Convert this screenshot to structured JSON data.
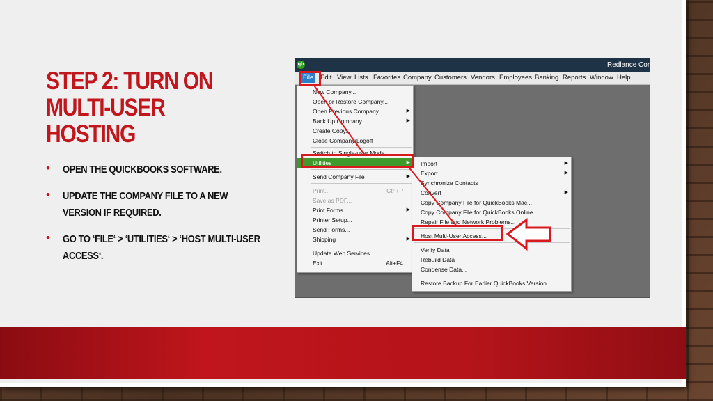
{
  "slide": {
    "title": "Step 2: Turn on Multi-User Hosting",
    "bullets": [
      "Open the QuickBooks software.",
      "Update the company file to a new version if required.",
      "Go to ‘File‘ > ‘Utilities‘ > ‘Host Multi-User Access‘."
    ],
    "bullet_symbol": "•"
  },
  "colors": {
    "accent_red": "#c0161c",
    "qb_green": "#2ca01c",
    "highlight_green": "#3d9a2b"
  },
  "screenshot": {
    "logo_text": "qb",
    "window_title": "Redlance Com",
    "menu": [
      "File",
      "Edit",
      "View",
      "Lists",
      "Favorites",
      "Company",
      "Customers",
      "Vendors",
      "Employees",
      "Banking",
      "Reports",
      "Window",
      "Help"
    ],
    "file_menu": [
      {
        "label": "New Company...",
        "disabled": false
      },
      {
        "label": "Open or Restore Company...",
        "disabled": false
      },
      {
        "label": "Open Previous Company",
        "submenu": true
      },
      {
        "label": "Back Up Company",
        "submenu": true
      },
      {
        "label": "Create Copy...",
        "disabled": false
      },
      {
        "label": "Close Company/Logoff",
        "disabled": false
      },
      {
        "label": "Switch to Single-user Mode",
        "disabled": false
      },
      {
        "label": "Utilities",
        "submenu": true,
        "highlight": true
      },
      {
        "label": "Send Company File",
        "submenu": true
      },
      {
        "label": "Print...",
        "shortcut": "Ctrl+P",
        "disabled": true
      },
      {
        "label": "Save as PDF...",
        "disabled": true
      },
      {
        "label": "Print Forms",
        "submenu": true
      },
      {
        "label": "Printer Setup...",
        "disabled": false
      },
      {
        "label": "Send Forms...",
        "disabled": false
      },
      {
        "label": "Shipping",
        "submenu": true
      },
      {
        "label": "Update Web Services",
        "disabled": false
      },
      {
        "label": "Exit",
        "shortcut": "Alt+F4"
      }
    ],
    "utilities_menu": [
      {
        "label": "Import",
        "submenu": true
      },
      {
        "label": "Export",
        "submenu": true
      },
      {
        "label": "Synchronize Contacts"
      },
      {
        "label": "Convert",
        "submenu": true
      },
      {
        "label": "Copy Company File for QuickBooks Mac..."
      },
      {
        "label": "Copy Company File for QuickBooks Online..."
      },
      {
        "label": "Repair File and Network Problems..."
      },
      {
        "label": "Host Multi-User Access..."
      },
      {
        "label": "Verify Data"
      },
      {
        "label": "Rebuild Data"
      },
      {
        "label": "Condense Data..."
      },
      {
        "label": "Restore Backup For Earlier QuickBooks Version"
      }
    ]
  }
}
